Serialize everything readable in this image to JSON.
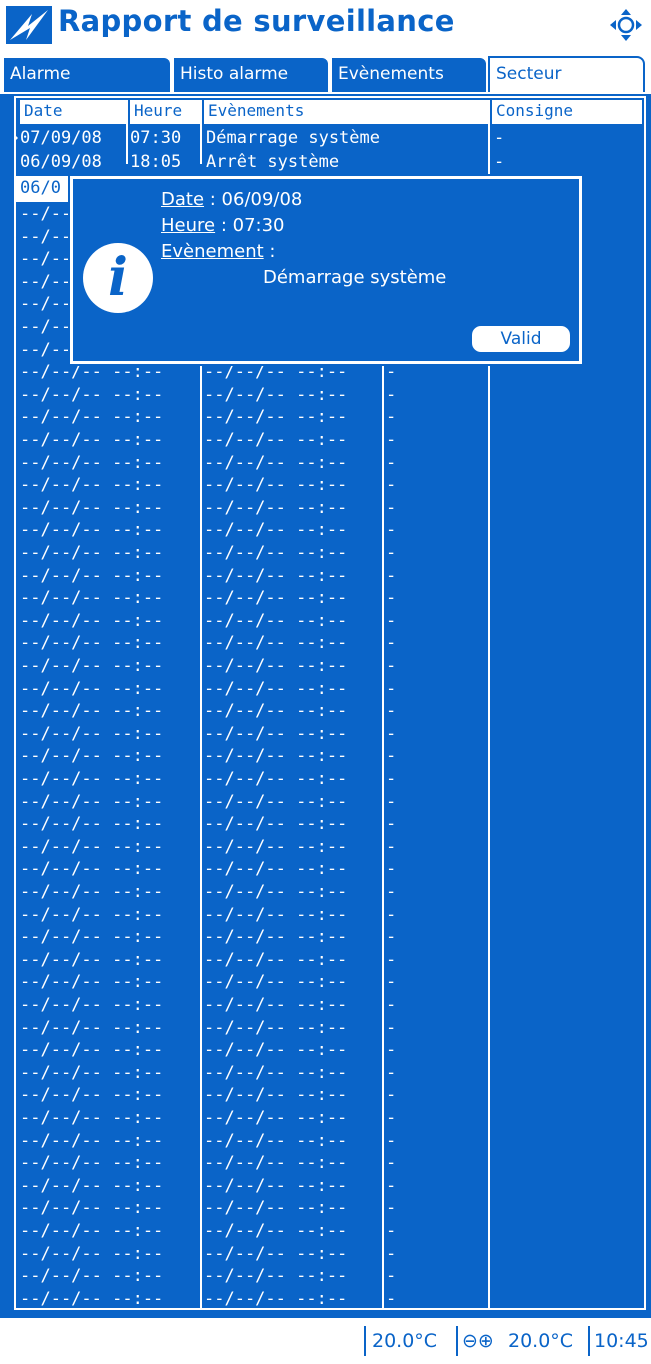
{
  "title": "Rapport de surveillance",
  "icons": {
    "logo": "lightning-logo-icon",
    "nav": "navigation-arrows-icon",
    "info": "info-icon"
  },
  "tabs": [
    {
      "label": "Alarme",
      "active": false
    },
    {
      "label": "Histo alarme",
      "active": false
    },
    {
      "label": "Evènements",
      "active": false
    },
    {
      "label": "Secteur",
      "active": true
    }
  ],
  "table": {
    "headers": {
      "date": "Date",
      "heure": "Heure",
      "evenements": "Evènements",
      "consigne": "Consigne"
    },
    "rows": [
      {
        "date": "07/09/08",
        "heure": "07:30",
        "event": "Démarrage système",
        "consigne": "-"
      },
      {
        "date": "06/09/08",
        "heure": "18:05",
        "event": "Arrêt système",
        "consigne": "-"
      },
      {
        "date": "06/0",
        "heure": "",
        "event": "",
        "consigne": ""
      }
    ],
    "empty_label": "--/--/-- --:--",
    "empty_value": "-"
  },
  "dialog": {
    "date_label": "Date",
    "date_value": "06/09/08",
    "heure_label": "Heure",
    "heure_value": "07:30",
    "event_label": "Evènement",
    "event_value": "Démarrage système",
    "button": "Valid"
  },
  "statusbar": {
    "temp1": "20.0°C",
    "adjust": "⊖⊕",
    "temp2": "20.0°C",
    "time": "10:45"
  },
  "colors": {
    "primary": "#0a64c8",
    "background": "#ffffff"
  }
}
